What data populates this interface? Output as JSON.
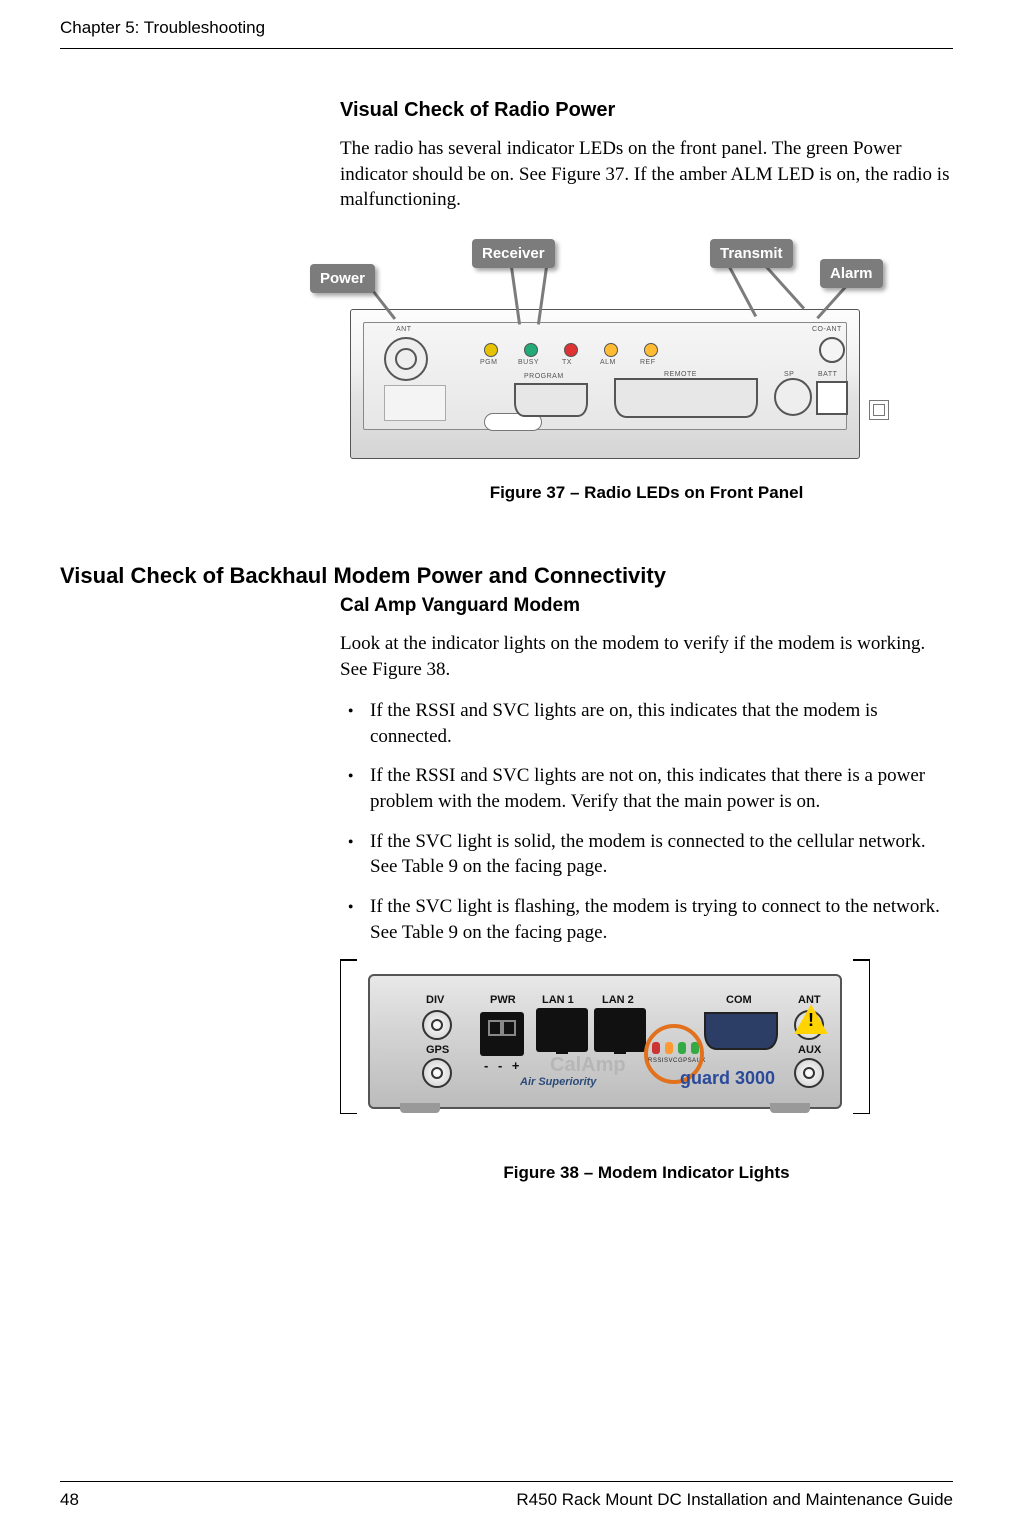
{
  "header": {
    "chapter": "Chapter 5: Troubleshooting"
  },
  "section1": {
    "heading": "Visual Check of Radio Power",
    "paragraph": "The radio has several indicator LEDs on the front panel. The green Power indicator should be on. See Figure 37. If the amber ALM LED is on, the radio is malfunctioning."
  },
  "figure37": {
    "callouts": {
      "power": "Power",
      "receiver": "Receiver",
      "transmit": "Transmit",
      "alarm": "Alarm"
    },
    "panel_labels": {
      "ant": "ANT",
      "pgm": "PGM",
      "busy": "BUSY",
      "tx": "TX",
      "alm": "ALM",
      "ref": "REF",
      "program": "PROGRAM",
      "remote": "REMOTE",
      "sp": "SP",
      "co_ant": "CO-ANT",
      "batt": "BATT"
    },
    "caption": "Figure 37  –  Radio LEDs on Front Panel"
  },
  "section2": {
    "heading": "Visual Check of Backhaul Modem Power and Connectivity",
    "subheading": "Cal Amp Vanguard Modem",
    "intro": "Look at the indicator lights on the modem to verify if the modem is working. See Figure 38.",
    "bullets": [
      "If the RSSI and SVC lights are on, this indicates that the modem is connected.",
      "If the RSSI and SVC lights are not on, this indicates that there is a power problem with the modem. Verify that the main power is on.",
      "If the SVC light is solid, the modem is connected to the cellular network. See Table 9 on the facing page.",
      "If the SVC light is flashing, the modem is trying to connect to the network. See Table 9 on the facing page."
    ]
  },
  "figure38": {
    "labels": {
      "div": "DIV",
      "pwr": "PWR",
      "lan1": "LAN 1",
      "lan2": "LAN 2",
      "com": "COM",
      "ant": "ANT",
      "gps": "GPS",
      "aux": "AUX",
      "rssi": "RSSI",
      "svc": "SVC",
      "gps_led": "GPS",
      "aux_led": "AUX",
      "plusminus": "- - +",
      "brand": "CalAmp",
      "tagline": "Air Superiority",
      "model": "guard 3000"
    },
    "caption": "Figure 38  –  Modem Indicator Lights"
  },
  "footer": {
    "page": "48",
    "doc": "R450 Rack Mount DC Installation and Maintenance Guide"
  }
}
